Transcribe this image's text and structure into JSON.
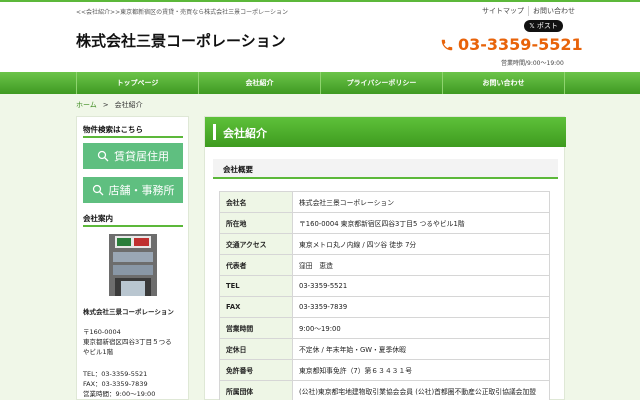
{
  "header": {
    "tagline": "<<会社紹介>>東京都新宿区の賃貸・売買なら株式会社三景コーポレーション",
    "sitemap": "サイトマップ",
    "contact_link": "お問い合わせ",
    "x_post": "𝕏 ポスト",
    "company": "株式会社三景コーポレーション",
    "phone": "03-3359-5521",
    "hours": "営業時間/9:00～19:00"
  },
  "nav": [
    "トップページ",
    "会社紹介",
    "プライバシーポリシー",
    "お問い合わせ"
  ],
  "breadcrumb": {
    "home": "ホーム",
    "sep": ">",
    "current": "会社紹介"
  },
  "sidebar": {
    "search_heading": "物件検索はこちら",
    "btn_rent": "賃貸居住用",
    "btn_shop": "店舗・事務所",
    "guide_heading": "会社案内",
    "company": "株式会社三景コーポレーション",
    "zip": "〒160-0004",
    "addr1": "東京都新宿区四谷3丁目５つる",
    "addr2": "やビル1階",
    "tel": "TEL：03-3359-5521",
    "fax": "FAX：03-3359-7839",
    "hours": "営業時間：9:00～19:00"
  },
  "main": {
    "title": "会社紹介",
    "section": "会社概要",
    "rows": [
      {
        "k": "会社名",
        "v": "株式会社三景コーポレーション"
      },
      {
        "k": "所在地",
        "v": "〒160-0004 東京都新宿区四谷3丁目5 つるやビル1階"
      },
      {
        "k": "交通アクセス",
        "v": "東京メトロ丸ノ内線 / 四ツ谷 徒歩 7分"
      },
      {
        "k": "代表者",
        "v": "窪田　恵造"
      },
      {
        "k": "TEL",
        "v": "03-3359-5521"
      },
      {
        "k": "FAX",
        "v": "03-3359-7839"
      },
      {
        "k": "営業時間",
        "v": "9:00～19:00"
      },
      {
        "k": "定休日",
        "v": "不定休 / 年末年始・GW・夏季休暇"
      },
      {
        "k": "免許番号",
        "v": "東京都知事免許（7）第６３４３１号"
      },
      {
        "k": "所属団体",
        "v": "(公社)東京都宅地建物取引業協会会員 (公社)首都圏不動産公正取引協議会加盟"
      }
    ]
  },
  "colors": {
    "accent": "#5cb83a",
    "phone": "#e8630a",
    "button": "#5fbf80"
  },
  "icons": {
    "phone": "phone-icon",
    "search": "search-icon"
  }
}
